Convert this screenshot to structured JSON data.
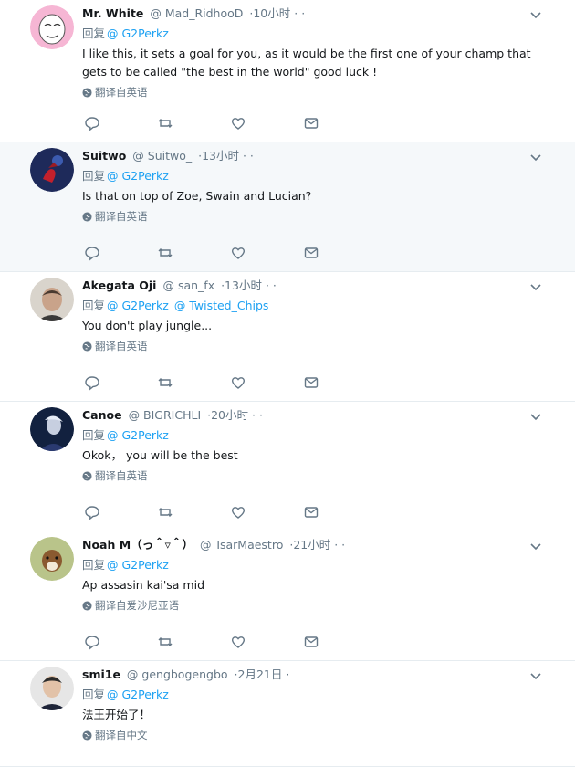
{
  "reply_prefix": "回复",
  "icon_names": {
    "reply": "reply-icon",
    "retweet": "retweet-icon",
    "like": "heart-icon",
    "dm": "envelope-icon",
    "chevron": "chevron-down-icon",
    "globe": "globe-icon"
  },
  "colors": {
    "link": "#1da1f2",
    "muted": "#657786",
    "highlight_bg": "#f5f8fa",
    "divider": "#e6ecf0"
  },
  "tweets": [
    {
      "name": "Mr. White",
      "handle": "@ Mad_RidhooD",
      "time": "·10小时",
      "dots": "· ·",
      "mentions": [
        "@ G2Perkz"
      ],
      "text": "I like this, it sets a goal for you, as it would be the first one of your champ that gets to be called \"the best in the world\" good luck !",
      "translate": "翻译自英语"
    },
    {
      "name": "Suitwo",
      "handle": "@ Suitwo_",
      "time": "·13小时",
      "dots": "· ·",
      "mentions": [
        "@ G2Perkz"
      ],
      "text": "Is that on top of Zoe, Swain and Lucian?",
      "translate": "翻译自英语"
    },
    {
      "name": "Akegata Oji",
      "handle": "@ san_fx",
      "time": "·13小时",
      "dots": "· ·",
      "mentions": [
        "@ G2Perkz",
        "@ Twisted_Chips"
      ],
      "text": "You don't play jungle...",
      "translate": "翻译自英语"
    },
    {
      "name": "Canoe",
      "handle": "@ BIGRICHLI",
      "time": "·20小时",
      "dots": "· ·",
      "mentions": [
        "@ G2Perkz"
      ],
      "text": "Okok， you will be the best",
      "translate": "翻译自英语"
    },
    {
      "name": "Noah M（っ＾▿＾）",
      "handle": "@ TsarMaestro",
      "time": "·21小时",
      "dots": "· ·",
      "mentions": [
        "@ G2Perkz"
      ],
      "text": "Ap assasin kai'sa mid",
      "translate": "翻译自爱沙尼亚语"
    },
    {
      "name": "smi1e",
      "handle": "@ gengbogengbo",
      "time": "·2月21日",
      "dots": "·",
      "mentions": [
        "@ G2Perkz"
      ],
      "text": "法王开始了！",
      "translate": "翻译自中文"
    }
  ]
}
